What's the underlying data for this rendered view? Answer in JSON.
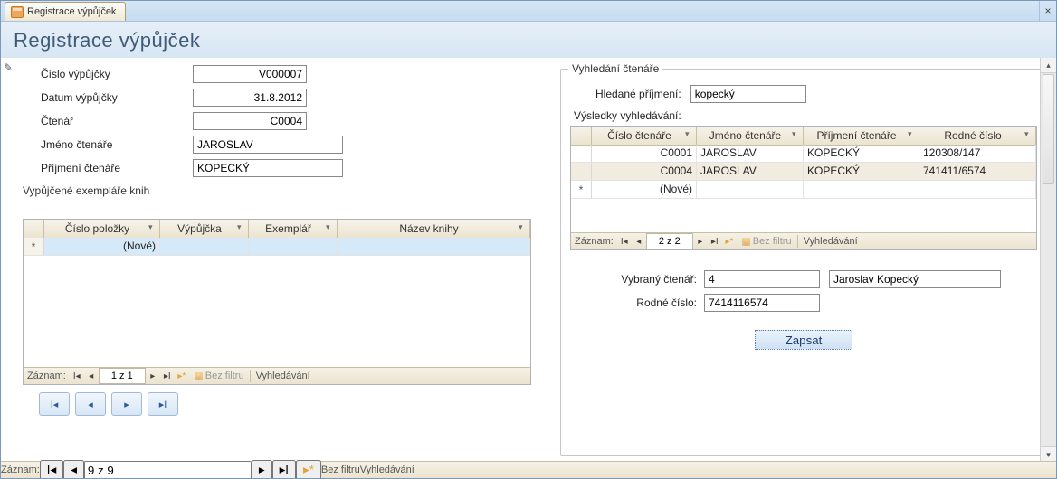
{
  "window": {
    "tab_title": "Registrace výpůjček",
    "close": "×",
    "page_title": "Registrace výpůjček"
  },
  "left": {
    "labels": {
      "loan_no": "Číslo výpůjčky",
      "loan_date": "Datum výpůjčky",
      "reader": "Čtenář",
      "first": "Jméno čtenáře",
      "last": "Příjmení čtenáře"
    },
    "values": {
      "loan_no": "V000007",
      "loan_date": "31.8.2012",
      "reader": "C0004",
      "first": "JAROSLAV",
      "last": "KOPECKÝ"
    },
    "items_caption": "Vypůjčené exempláře knih",
    "cols": {
      "item_no": "Číslo položky",
      "loan": "Výpůjčka",
      "copy": "Exemplář",
      "title": "Název knihy"
    },
    "new_row": "(Nové)",
    "nav": {
      "label": "Záznam:",
      "pos": "1 z 1",
      "nofilter": "Bez filtru",
      "search": "Vyhledávání"
    }
  },
  "right": {
    "legend": "Vyhledání čtenáře",
    "search_label": "Hledané příjmení:",
    "search_value": "kopecký",
    "results_caption": "Výsledky vyhledávání:",
    "cols": {
      "rid": "Číslo čtenáře",
      "first": "Jméno čtenáře",
      "last": "Příjmení čtenáře",
      "birth": "Rodné číslo"
    },
    "rows": [
      {
        "rid": "C0001",
        "first": "JAROSLAV",
        "last": "KOPECKÝ",
        "birth": "120308/147"
      },
      {
        "rid": "C0004",
        "first": "JAROSLAV",
        "last": "KOPECKÝ",
        "birth": "741411/6574"
      }
    ],
    "new_row": "(Nové)",
    "nav": {
      "label": "Záznam:",
      "pos": "2 z 2",
      "nofilter": "Bez filtru",
      "search": "Vyhledávání"
    },
    "picked": {
      "sel_label": "Vybraný čtenář:",
      "sel_id": "4",
      "sel_name": "Jaroslav Kopecký",
      "birth_label": "Rodné číslo:",
      "birth": "7414116574"
    },
    "save": "Zapsat"
  },
  "footer": {
    "label": "Záznam:",
    "pos": "9 z 9",
    "nofilter": "Bez filtru",
    "search": "Vyhledávání"
  }
}
